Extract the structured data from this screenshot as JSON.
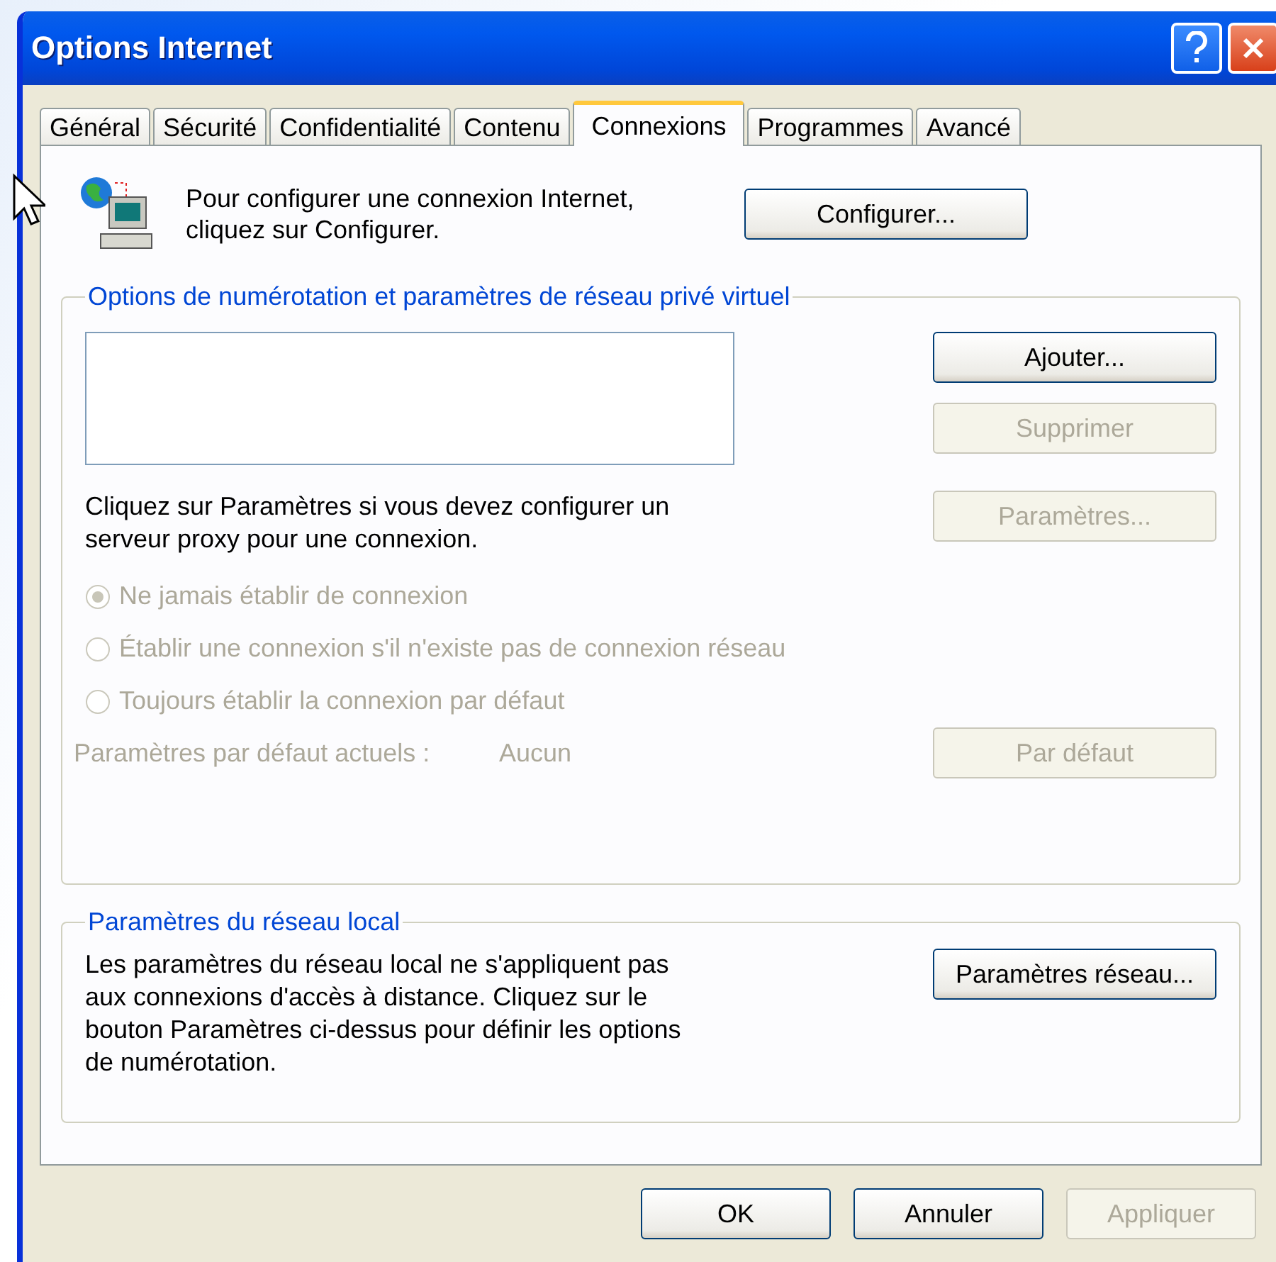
{
  "window": {
    "title": "Options Internet"
  },
  "tabs": [
    {
      "label": "Général",
      "selected": false
    },
    {
      "label": "Sécurité",
      "selected": false
    },
    {
      "label": "Confidentialité",
      "selected": false
    },
    {
      "label": "Contenu",
      "selected": false
    },
    {
      "label": "Connexions",
      "selected": true
    },
    {
      "label": "Programmes",
      "selected": false
    },
    {
      "label": "Avancé",
      "selected": false
    }
  ],
  "setup": {
    "text": "Pour configurer une connexion Internet,\ncliquez sur Configurer.",
    "button": {
      "label": "Configurer...",
      "disabled": false
    }
  },
  "dialup_group": {
    "legend": "Options de numérotation et paramètres de réseau privé virtuel",
    "buttons": [
      {
        "label": "Ajouter...",
        "disabled": false
      },
      {
        "label": "Supprimer",
        "disabled": true
      }
    ],
    "proxy_text": "Cliquez sur Paramètres si vous devez configurer un serveur proxy pour une connexion.",
    "proxy_button": {
      "label": "Paramètres...",
      "disabled": true
    },
    "radios": [
      {
        "label": "Ne jamais établir de connexion",
        "selected": true,
        "disabled": true
      },
      {
        "label": "Établir une connexion s'il n'existe pas de connexion réseau",
        "selected": false,
        "disabled": true
      },
      {
        "label": "Toujours établir la connexion par défaut",
        "selected": false,
        "disabled": true
      }
    ],
    "default_label": "Paramètres par défaut actuels :",
    "default_value": "Aucun",
    "default_disabled": true,
    "default_button": {
      "label": "Par défaut",
      "disabled": true
    }
  },
  "lan_group": {
    "legend": "Paramètres du réseau local",
    "text": "Les paramètres du réseau local ne s'appliquent pas aux connexions d'accès à distance. Cliquez sur le bouton Paramètres ci-dessus pour définir les options de numérotation.",
    "button": {
      "label": "Paramètres réseau...",
      "disabled": false
    }
  },
  "footer": [
    {
      "label": "OK",
      "disabled": false
    },
    {
      "label": "Annuler",
      "disabled": false
    },
    {
      "label": "Appliquer",
      "disabled": true
    }
  ]
}
